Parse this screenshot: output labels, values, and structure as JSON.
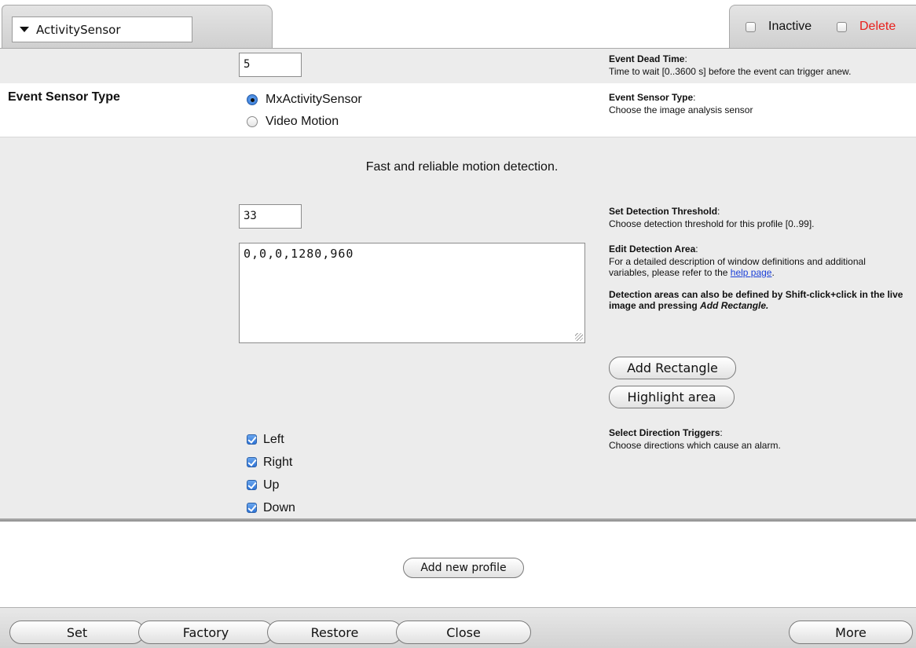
{
  "profile": {
    "name": "ActivitySensor",
    "inactive_label": "Inactive",
    "delete_label": "Delete",
    "inactive_checked": false,
    "delete_checked": false
  },
  "dead_time": {
    "value": "5",
    "title": "Event Dead Time",
    "text": "Time to wait [0..3600 s] before the event can trigger anew."
  },
  "sensor_type": {
    "label": "Event Sensor Type",
    "options": [
      {
        "label": "MxActivitySensor",
        "selected": true
      },
      {
        "label": "Video Motion",
        "selected": false
      }
    ],
    "help_title": "Event Sensor Type",
    "help_text": "Choose the image analysis sensor"
  },
  "activity": {
    "description": "Fast and reliable motion detection.",
    "threshold_value": "33",
    "threshold_title": "Set Detection Threshold",
    "threshold_text": "Choose detection threshold for this profile [0..99].",
    "area_value": "0,0,0,1280,960",
    "area_title": "Edit Detection Area",
    "area_text": "For a detailed description of window definitions and additional variables, please refer to the",
    "area_link": "help page",
    "area_note": "Detection areas can also be defined by Shift-click+click in the live image and pressing",
    "area_note_em": "Add Rectangle.",
    "add_rectangle": "Add Rectangle",
    "highlight_area": "Highlight area",
    "directions": [
      {
        "label": "Left",
        "checked": true
      },
      {
        "label": "Right",
        "checked": true
      },
      {
        "label": "Up",
        "checked": true
      },
      {
        "label": "Down",
        "checked": true
      }
    ],
    "directions_title": "Select Direction Triggers",
    "directions_text": "Choose directions which cause an alarm."
  },
  "add_profile_label": "Add new profile",
  "footer": {
    "set": "Set",
    "factory": "Factory",
    "restore": "Restore",
    "close": "Close",
    "more": "More"
  },
  "colors": {
    "delete": "#e8201c",
    "link": "#1a3fd8",
    "section_gray": "#ececec"
  }
}
